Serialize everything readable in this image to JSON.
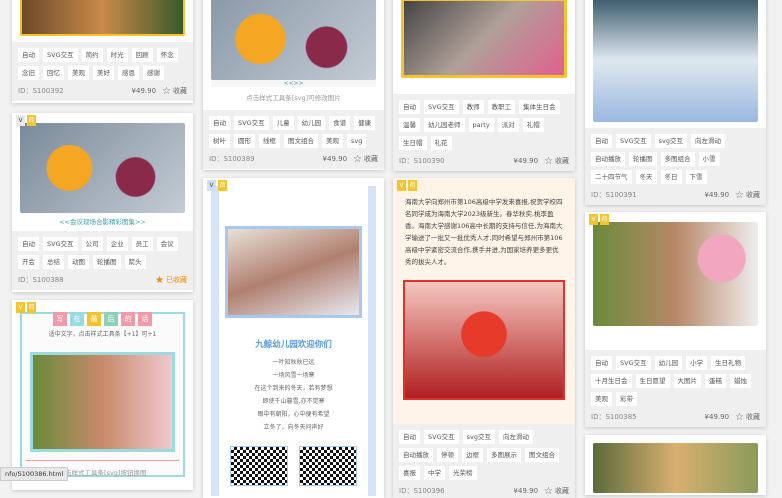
{
  "cards": [
    {
      "id": "ID：S100392",
      "price": "¥49.90",
      "fav": "收藏",
      "tags": [
        "自动",
        "SVG交互",
        "简约",
        "时光",
        "回顾",
        "怀念",
        "念旧",
        "回忆",
        "美观",
        "美好",
        "感恩",
        "感谢"
      ]
    },
    {
      "id": "ID：S100388",
      "price": "",
      "fav": "已收藏",
      "caption": "<<会议现场合影精彩图集>>",
      "tags": [
        "自动",
        "SVG交互",
        "公司",
        "企业",
        "员工",
        "会议",
        "开会",
        "总结",
        "动图",
        "轮播图",
        "箭头"
      ]
    },
    {
      "title_chars": [
        "写",
        "在",
        "最",
        "后",
        "的",
        "话"
      ],
      "subtitle": "适中文字，点击样式工具条【+1】可+1",
      "caption": "点击样式工具条[svg]按钮换图"
    },
    {
      "id": "ID：S100389",
      "price": "¥49.90",
      "fav": "收藏",
      "arrows": "<<>>",
      "caption": "点击样式工具条[svg]可修改图片",
      "tags": [
        "自动",
        "SVG交互",
        "儿童",
        "幼儿园",
        "食谱",
        "健康",
        "树叶",
        "圆形",
        "线框",
        "图文组合",
        "美观",
        "svg"
      ]
    },
    {
      "title": "九鲸幼儿园欢迎你们",
      "poem": [
        "一叶知秋秋已远",
        "一场风雪一场寒",
        "在这个到来的冬天，若有梦想",
        "即使千山暮雪,亦不觉寒",
        "眼中有朝阳，心中便有希望",
        "立冬了，向冬天问声好"
      ]
    },
    {
      "id": "ID：S100390",
      "price": "¥49.90",
      "fav": "收藏",
      "tags": [
        "自动",
        "SVG交互",
        "教师",
        "教职工",
        "集体生日会",
        "温馨",
        "幼儿园老师",
        "party",
        "派对",
        "礼帽",
        "生日帽",
        "礼花"
      ]
    },
    {
      "id": "ID：S100396",
      "price": "¥49.90",
      "fav": "收藏",
      "text": "海南大学向郑州市第106高级中学发来喜报,祝贺学校四名同学成为海南大学2023级新生。春华秋实,桃李盈香。海南大学感谢106高中长期的支持与信任,为海南大学输送了一批又一批优秀人才,同时希望与郑州市第106高级中学紧密交流合作,携手并进,为国家培养更多更优秀的拔尖人才。",
      "tags": [
        "自动",
        "SVG交互",
        "svg交互",
        "向左滑动",
        "自动播放",
        "停顿",
        "边框",
        "多图展示",
        "图文组合",
        "喜报",
        "中学",
        "光荣榜"
      ]
    },
    {
      "id": "ID：S100391",
      "price": "¥49.90",
      "fav": "收藏",
      "tags": [
        "自动",
        "SVG交互",
        "svg交互",
        "向左滑动",
        "自动播放",
        "轮播图",
        "多图组合",
        "小雪",
        "二十四节气",
        "冬天",
        "冬日",
        "下雪"
      ]
    },
    {
      "id": "ID：S100385",
      "price": "¥49.90",
      "fav": "收藏",
      "tags": [
        "自动",
        "SVG交互",
        "幼儿园",
        "小学",
        "生日礼物",
        "十月生日会",
        "生日愿望",
        "大图片",
        "蛋糕",
        "蜡烛",
        "美观",
        "彩带"
      ]
    }
  ],
  "badges": {
    "v": "V",
    "vip": "荷"
  },
  "status_url": "nfo/S100386.html",
  "colors": {
    "accent": "#f08a00",
    "tagbg": "#ffffff",
    "footbg": "#efefef"
  }
}
